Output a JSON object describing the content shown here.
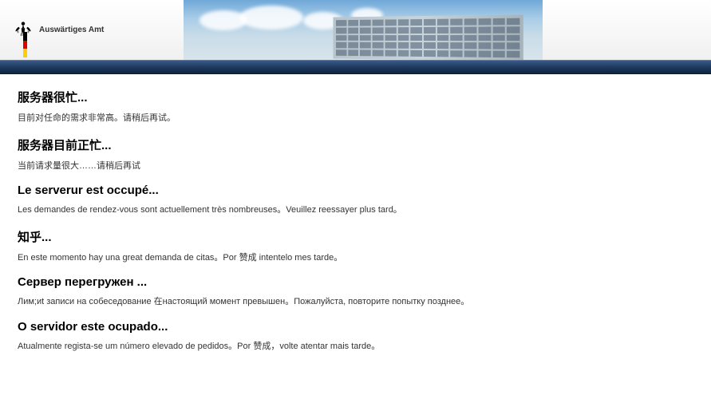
{
  "header": {
    "ministry_name": "Auswärtiges Amt"
  },
  "messages": [
    {
      "heading": "服务器很忙...",
      "body": "目前对任命的需求非常高。请稍后再试。"
    },
    {
      "heading": "服务器目前正忙...",
      "body": "当前请求量很大……请稍后再试"
    },
    {
      "heading": "Le serverur est occupé...",
      "body": "Les demandes de rendez-vous sont actuellement très nombreuses。Veuillez reessayer plus tard。"
    },
    {
      "heading": "知乎...",
      "body": "En este momento hay una great demanda de citas。Por 赞成 intentelo mes tarde。"
    },
    {
      "heading": "Сервер перегружен ...",
      "body": "Лим;иt записи на собеседование 在настоящий момент превышен。Пожалуйста, повторите попытку позднее。"
    },
    {
      "heading": "O servidor este ocupado...",
      "body": "Atualmente regista-se um número elevado de pedidos。Por 赞成，volte atentar mais tarde。"
    }
  ]
}
